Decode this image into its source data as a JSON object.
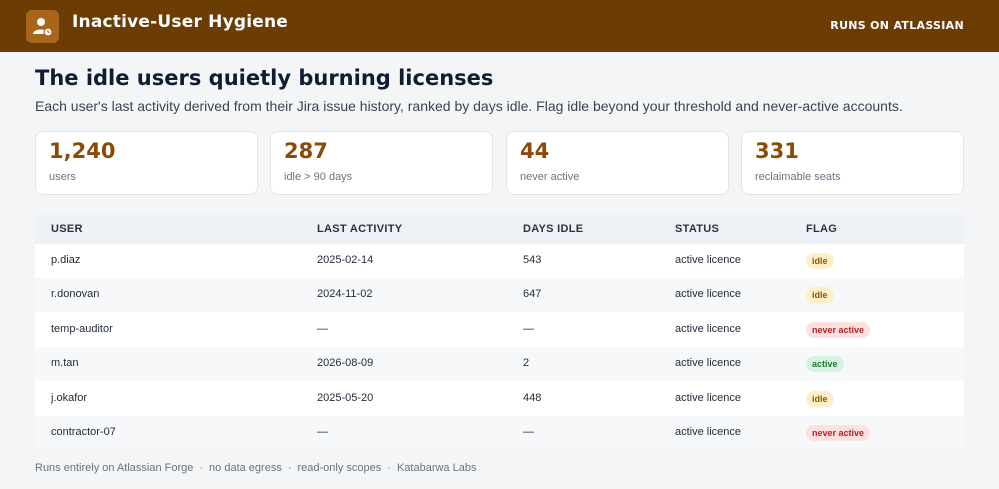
{
  "header": {
    "app_icon": "user-clock-icon",
    "title": "Inactive-User Hygiene",
    "runs_on": "RUNS ON ATLASSIAN",
    "colors": {
      "bar": "#6b3d05",
      "icon_bg": "#a8661b"
    }
  },
  "main": {
    "title": "The idle users quietly burning licenses",
    "subtitle": "Each user's last activity derived from their Jira issue history, ranked by days idle. Flag idle beyond your threshold and never-active accounts."
  },
  "stats": [
    {
      "value": "1,240",
      "label": "users"
    },
    {
      "value": "287",
      "label": "idle > 90 days"
    },
    {
      "value": "44",
      "label": "never active"
    },
    {
      "value": "331",
      "label": "reclaimable seats"
    }
  ],
  "table": {
    "columns": [
      "USER",
      "LAST ACTIVITY",
      "DAYS IDLE",
      "STATUS",
      "FLAG"
    ],
    "rows": [
      {
        "user": "p.diaz",
        "last_activity": "2025-02-14",
        "days_idle": "543",
        "status": "active licence",
        "flag": "idle",
        "flag_kind": "idle"
      },
      {
        "user": "r.donovan",
        "last_activity": "2024-11-02",
        "days_idle": "647",
        "status": "active licence",
        "flag": "idle",
        "flag_kind": "idle"
      },
      {
        "user": "temp-auditor",
        "last_activity": "—",
        "days_idle": "—",
        "status": "active licence",
        "flag": "never active",
        "flag_kind": "never"
      },
      {
        "user": "m.tan",
        "last_activity": "2026-08-09",
        "days_idle": "2",
        "status": "active licence",
        "flag": "active",
        "flag_kind": "active"
      },
      {
        "user": "j.okafor",
        "last_activity": "2025-05-20",
        "days_idle": "448",
        "status": "active licence",
        "flag": "idle",
        "flag_kind": "idle"
      },
      {
        "user": "contractor-07",
        "last_activity": "—",
        "days_idle": "—",
        "status": "active licence",
        "flag": "never active",
        "flag_kind": "never"
      }
    ],
    "flag_colors": {
      "idle": {
        "bg": "#fdf0c8",
        "fg": "#8a5a00"
      },
      "never": {
        "bg": "#fde0e0",
        "fg": "#b42323"
      },
      "active": {
        "bg": "#d8f3df",
        "fg": "#1f7a3a"
      }
    }
  },
  "footer": {
    "items": [
      "Runs entirely on Atlassian Forge",
      "no data egress",
      "read-only scopes",
      "Katabarwa Labs"
    ],
    "separator": "·"
  }
}
